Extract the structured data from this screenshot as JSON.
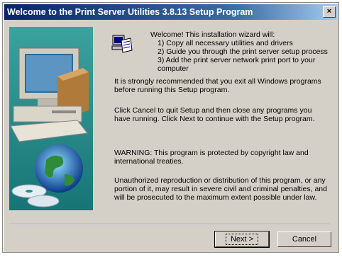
{
  "window": {
    "title": "Welcome to the Print Server Utilities 3.8.13 Setup Program",
    "close_glyph": "×"
  },
  "welcome": {
    "heading": "Welcome! This installation wizard will:",
    "items": [
      "1) Copy all necessary utilities and drivers",
      "2) Guide you through the print server setup process",
      "3) Add the print server network print port to your",
      "computer"
    ]
  },
  "paragraphs": {
    "exit_programs": "It is strongly recommended that you exit all Windows programs before running this Setup program.",
    "cancel_next": "Click Cancel to quit Setup and then close any programs you have running.  Click Next to continue with the Setup program.",
    "warning": "WARNING: This program is protected by copyright law and international treaties.",
    "unauthorized": "Unauthorized reproduction or distribution of this program, or any portion of it, may result in severe civil and criminal penalties, and will be prosecuted to the maximum extent possible under law."
  },
  "buttons": {
    "next": "Next >",
    "cancel": "Cancel"
  },
  "colors": {
    "titlebar": "#0a246a",
    "dialog_bg": "#d4d0c8",
    "art_bg": "#1f8f8c"
  },
  "icons": {
    "art": "computer-cd-globe-illustration",
    "setup": "setup-computer-icon"
  }
}
